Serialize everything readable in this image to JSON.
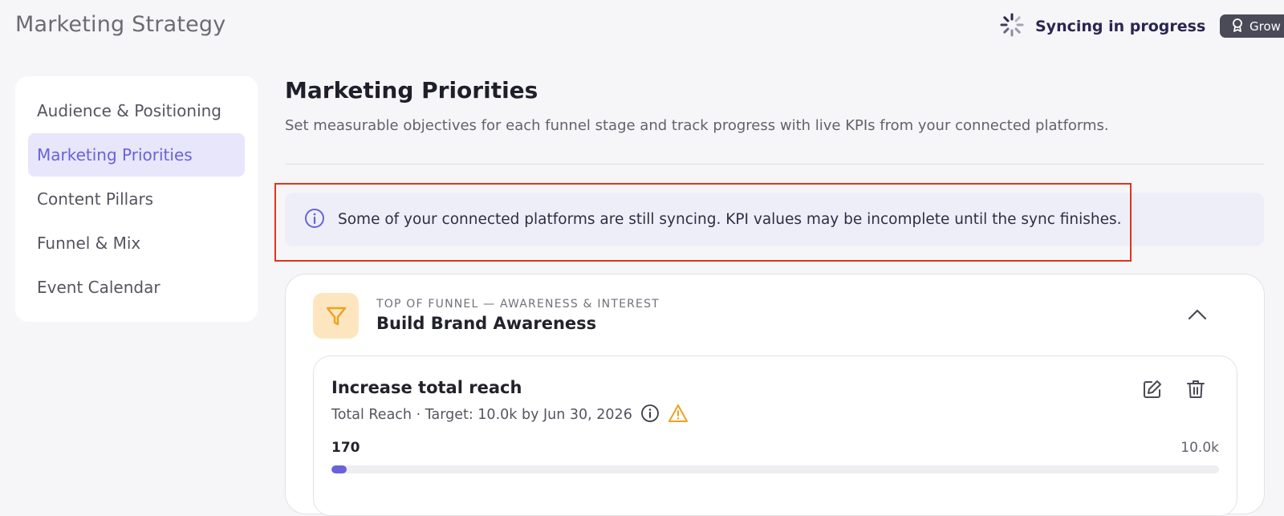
{
  "header": {
    "title": "Marketing Strategy",
    "sync_label": "Syncing in progress",
    "badge_label": "Grow"
  },
  "sidebar": {
    "items": [
      {
        "label": "Audience & Positioning",
        "active": false
      },
      {
        "label": "Marketing Priorities",
        "active": true
      },
      {
        "label": "Content Pillars",
        "active": false
      },
      {
        "label": "Funnel & Mix",
        "active": false
      },
      {
        "label": "Event Calendar",
        "active": false
      }
    ]
  },
  "main": {
    "title": "Marketing Priorities",
    "description": "Set measurable objectives for each funnel stage and track progress with live KPIs from your connected platforms.",
    "notice": "Some of your connected platforms are still syncing. KPI values may be incomplete until the sync finishes.",
    "funnel": {
      "kicker": "TOP OF FUNNEL — AWARENESS & INTEREST",
      "title": "Build Brand Awareness",
      "objective": {
        "title": "Increase total reach",
        "meta": "Total Reach · Target: 10.0k by Jun 30, 2026",
        "current_label": "170",
        "target_label": "10.0k",
        "progress_fraction": 0.017
      }
    }
  },
  "icons": {
    "spinner": "loading-spinner-icon",
    "badge": "award-ribbon-icon",
    "notice": "info-circle-icon",
    "funnel": "filter-funnel-icon",
    "collapse": "chevron-up-icon",
    "info": "info-circle-icon",
    "warning": "warning-triangle-icon",
    "edit": "pencil-square-icon",
    "delete": "trash-icon"
  },
  "colors": {
    "accent": "#6a62d8",
    "highlight": "#e0341c",
    "warning": "#f0a01f",
    "funnel_icon_bg": "#fde6bf"
  }
}
